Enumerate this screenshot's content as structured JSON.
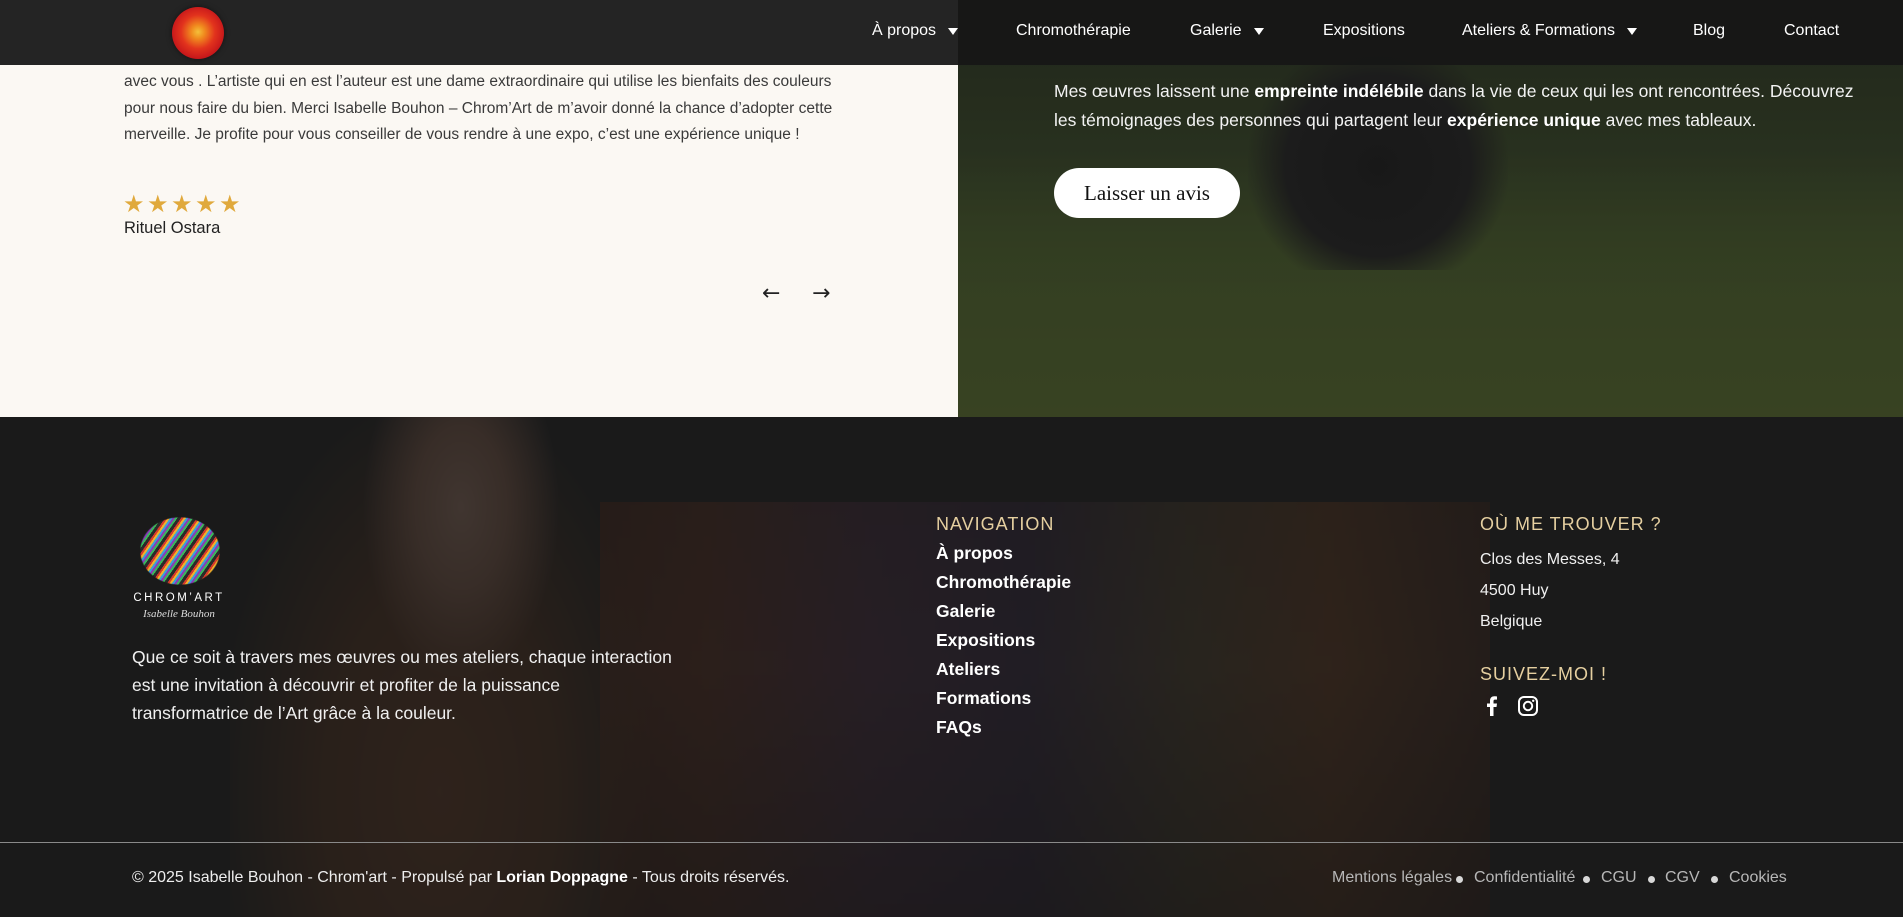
{
  "header": {
    "nav": [
      {
        "label": "À propos",
        "has_dropdown": true
      },
      {
        "label": "Chromothérapie",
        "has_dropdown": false
      },
      {
        "label": "Galerie",
        "has_dropdown": true
      },
      {
        "label": "Expositions",
        "has_dropdown": false
      },
      {
        "label": "Ateliers & Formations",
        "has_dropdown": true
      },
      {
        "label": "Blog",
        "has_dropdown": false
      },
      {
        "label": "Contact",
        "has_dropdown": false
      }
    ]
  },
  "testimonial": {
    "lines": [
      "avec vous . L’artiste qui en est l’auteur est une dame extraordinaire qui utilise les bienfaits des couleurs",
      "pour nous faire du bien. Merci Isabelle Bouhon – Chrom’Art de m’avoir donné la chance d’adopter cette",
      "merveille. Je profite pour vous conseiller de vous rendre à une expo, c’est une expérience unique !"
    ],
    "rating": 5,
    "author": "Rituel Ostara",
    "prev_arrow": "←",
    "next_arrow": "→"
  },
  "reviews_panel": {
    "line1_a": "Mes œuvres laissent une ",
    "line1_b": "empreinte indélébile",
    "line1_c": " dans la vie de ceux qui les ont rencontrées. Découvrez",
    "line2_a": "les témoignages des personnes qui partagent leur ",
    "line2_b": "expérience unique",
    "line2_c": " avec mes tableaux.",
    "button": "Laisser un avis"
  },
  "footer": {
    "logo_name": "CHROM’ART",
    "logo_sub": "Isabelle Bouhon",
    "tagline": [
      "Que ce soit à travers mes œuvres ou mes ateliers, chaque interaction",
      "est une invitation à découvrir et profiter de la puissance",
      "transformatrice de l’Art grâce à la couleur."
    ],
    "nav_heading": "NAVIGATION",
    "nav_links": [
      "À propos",
      "Chromothérapie",
      "Galerie",
      "Expositions",
      "Ateliers",
      "Formations",
      "FAQs"
    ],
    "location_heading": "OÙ ME TROUVER ?",
    "address": [
      "Clos des Messes, 4",
      "4500 Huy",
      "Belgique"
    ],
    "follow_heading": "SUIVEZ-MOI !",
    "social": [
      "facebook-icon",
      "instagram-icon"
    ],
    "copyright_a": "© 2025 Isabelle Bouhon - Chrom'art - Propulsé par ",
    "copyright_credit": "Lorian Doppagne",
    "copyright_b": " - Tous droits réservés.",
    "legal_links": [
      "Mentions légales",
      "Confidentialité",
      "CGU",
      "CGV",
      "Cookies"
    ]
  },
  "colors": {
    "star": "#e0a93c",
    "footer_heading": "#e5cfa0",
    "testimonial_bg": "#fbf8f3"
  }
}
